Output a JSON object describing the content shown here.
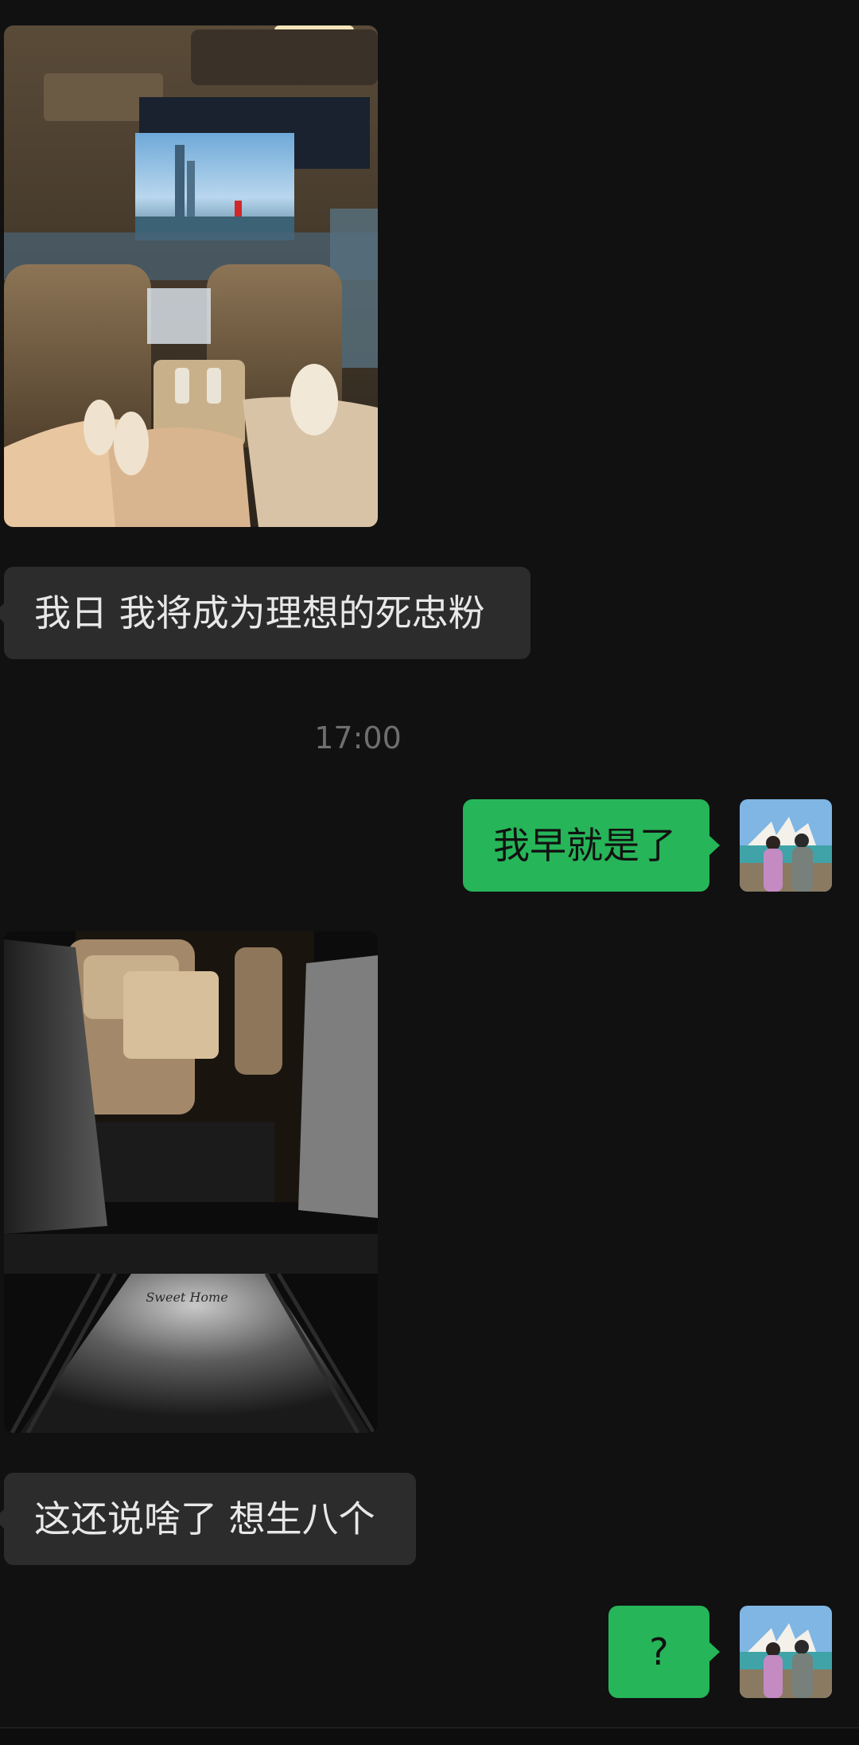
{
  "messages": [
    {
      "id": "m1",
      "type": "image",
      "side": "left",
      "alt": "car interior with screen"
    },
    {
      "id": "m2",
      "type": "text",
      "side": "left",
      "text": "我日 我将成为理想的死忠粉"
    },
    {
      "id": "t1",
      "type": "timestamp",
      "text": "17:00"
    },
    {
      "id": "m3",
      "type": "text",
      "side": "right",
      "text": "我早就是了"
    },
    {
      "id": "m4",
      "type": "image",
      "side": "left",
      "alt": "car door with welcome light"
    },
    {
      "id": "m5",
      "type": "text",
      "side": "left",
      "text": "这还说啥了 想生八个"
    },
    {
      "id": "m6",
      "type": "text",
      "side": "right",
      "text": "?"
    }
  ],
  "projection_text": "Sweet Home",
  "colors": {
    "background": "#111111",
    "incoming_bubble": "#2c2c2c",
    "outgoing_bubble": "#26b558"
  }
}
